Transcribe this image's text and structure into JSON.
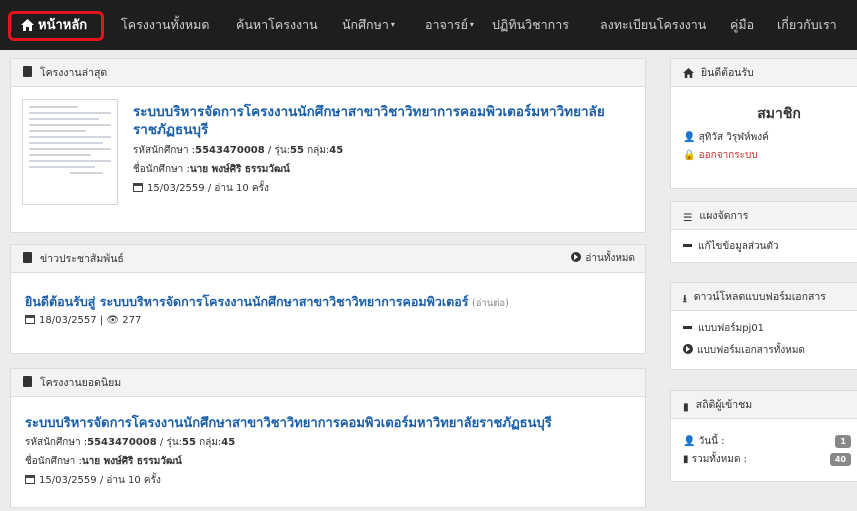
{
  "nav": {
    "home": "หน้าหลัก",
    "items": [
      "โครงงานทั้งหมด",
      "ค้นหาโครงงาน",
      "นักศึกษา",
      "อาจารย์",
      "ปฏิทินวิชาการ",
      "ลงทะเบียนโครงงาน",
      "คู่มือ",
      "เกี่ยวกับเรา"
    ]
  },
  "latest": {
    "header": "โครงงานล่าสุด",
    "title": "ระบบบริหารจัดการโครงงานนักศึกษาสาขาวิชาวิทยาการคอมพิวเตอร์มหาวิทยาลัยราชภัฏธนบุรี",
    "student_id_label": "รหัสนักศึกษา :",
    "student_id": "5543470008",
    "gen_label": " / รุ่น:",
    "gen": "55",
    "group_label": " กลุ่ม:",
    "group": "45",
    "name_label": "ชื่อนักศึกษา :",
    "name": "นาย พงษ์ศิริ ธรรมวัฒน์",
    "date_reads": "15/03/2559 / อ่าน 10 ครั้ง"
  },
  "news": {
    "header": "ข่าวประชาสัมพันธ์",
    "read_all": "อ่านทั้งหมด",
    "title": "ยินดีต้อนรับสู่ ระบบบริหารจัดการโครงงานนักศึกษาสาขาวิชาวิทยาการคอมพิวเตอร์",
    "more": "(อ่านต่อ)",
    "date": "18/03/2557",
    "views": "277"
  },
  "popular": {
    "header": "โครงงานยอดนิยม",
    "title": "ระบบบริหารจัดการโครงงานนักศึกษาสาขาวิชาวิทยาการคอมพิวเตอร์มหาวิทยาลัยราชภัฏธนบุรี",
    "student_id_label": "รหัสนักศึกษา :",
    "student_id": "5543470008",
    "gen_label": " / รุ่น:",
    "gen": "55",
    "group_label": " กลุ่ม:",
    "group": "45",
    "name_label": "ชื่อนักศึกษา :",
    "name": "นาย พงษ์ศิริ ธรรมวัฒน์",
    "date_reads": "15/03/2559 / อ่าน 10 ครั้ง"
  },
  "welcome": {
    "header": "ยินดีต้อนรับ",
    "member": "สมาชิก",
    "user": "สุทิวัส วิรุฬห์พงค์",
    "logout": "ออกจากระบบ"
  },
  "manage": {
    "header": "แผงจัดการ",
    "edit_profile": "แก้ไขข้อมูลส่วนตัว"
  },
  "downloads": {
    "header": "ดาวน์โหลดแบบฟอร์มเอกสาร",
    "form": "แบบฟอร์มpj01",
    "all": "แบบฟอร์มเอกสารทั้งหมด"
  },
  "stats": {
    "header": "สถิติผู้เข้าชม",
    "today_label": "วันนี้ :",
    "today": "1",
    "total_label": "รวมทั้งหมด :",
    "total": "40"
  }
}
